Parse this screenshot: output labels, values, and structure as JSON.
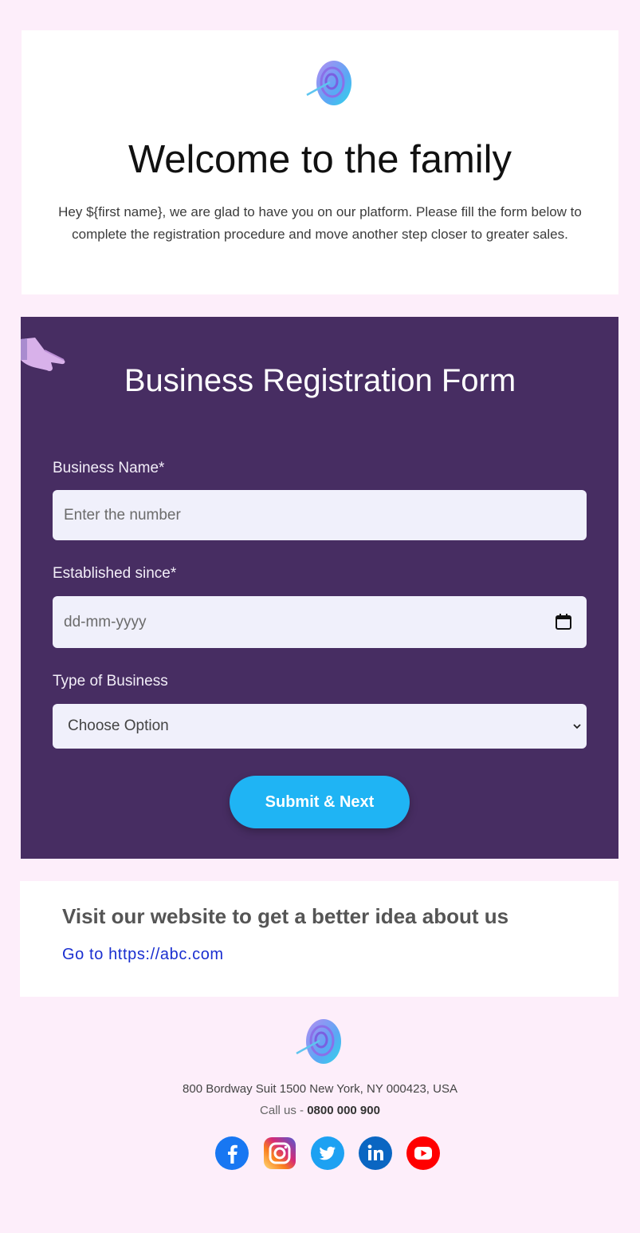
{
  "welcome": {
    "title": "Welcome to the family",
    "text": "Hey ${first name}, we are glad to have you on our platform. Please fill the form below to complete the registration procedure and move another step closer to greater sales."
  },
  "form": {
    "title": "Business Registration Form",
    "business_name_label": "Business Name*",
    "business_name_placeholder": "Enter the number",
    "established_label": "Established since*",
    "established_placeholder": "dd-mm-yyyy",
    "type_label": "Type of Business",
    "type_selected": "Choose Option",
    "submit_label": "Submit & Next"
  },
  "visit": {
    "title": "Visit our website to get a better idea about us",
    "link": "Go to https://abc.com"
  },
  "footer": {
    "address": "800 Bordway Suit 1500 New York, NY 000423, USA",
    "call_prefix": "Call us - ",
    "phone": "0800 000 900",
    "social": [
      "facebook-icon",
      "instagram-icon",
      "twitter-icon",
      "linkedin-icon",
      "youtube-icon"
    ]
  },
  "colors": {
    "page_bg": "#fdeefa",
    "form_bg": "#472d62",
    "button": "#1fb4f4",
    "link": "#1a2fd0"
  }
}
